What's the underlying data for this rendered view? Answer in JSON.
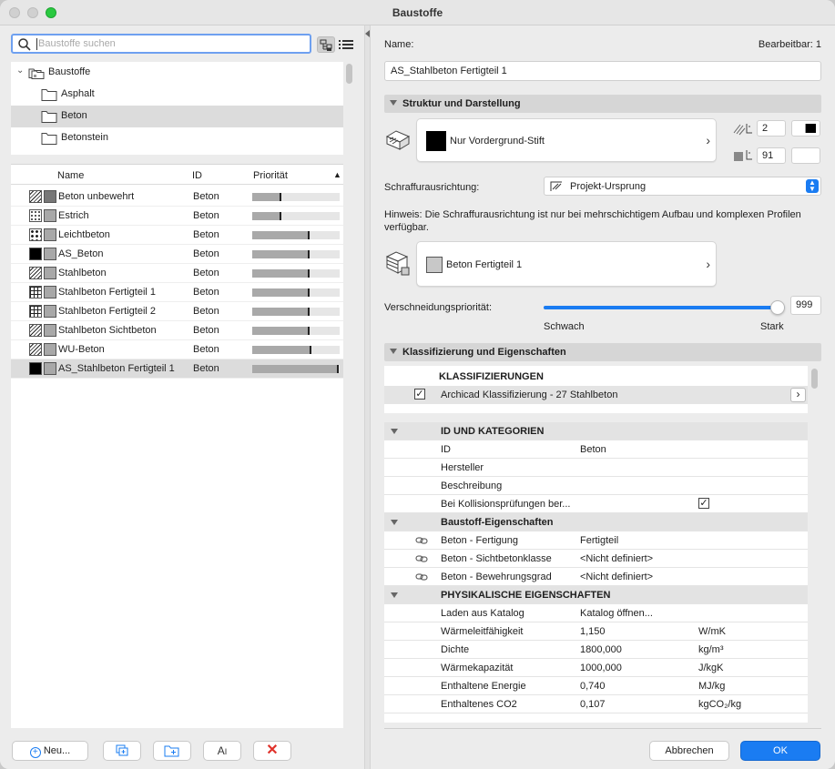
{
  "window": {
    "title": "Baustoffe"
  },
  "search": {
    "placeholder": "Baustoffe suchen"
  },
  "tree": {
    "root": "Baustoffe",
    "items": [
      "Asphalt",
      "Beton",
      "Betonstein"
    ]
  },
  "list": {
    "headers": {
      "name": "Name",
      "id": "ID",
      "priority": "Priorität"
    },
    "rows": [
      {
        "name": "Beton unbewehrt",
        "id": "Beton",
        "priority": 0.33,
        "pattern": "hatch",
        "color": "#777777"
      },
      {
        "name": "Estrich",
        "id": "Beton",
        "priority": 0.33,
        "pattern": "dots",
        "color": "#a8a8a8"
      },
      {
        "name": "Leichtbeton",
        "id": "Beton",
        "priority": 0.66,
        "pattern": "gravel",
        "color": "#a8a8a8"
      },
      {
        "name": "AS_Beton",
        "id": "Beton",
        "priority": 0.66,
        "pattern": "solid",
        "color": "#a8a8a8"
      },
      {
        "name": "Stahlbeton",
        "id": "Beton",
        "priority": 0.66,
        "pattern": "hatch",
        "color": "#a8a8a8"
      },
      {
        "name": "Stahlbeton Fertigteil 1",
        "id": "Beton",
        "priority": 0.66,
        "pattern": "grid",
        "color": "#a8a8a8"
      },
      {
        "name": "Stahlbeton Fertigteil 2",
        "id": "Beton",
        "priority": 0.66,
        "pattern": "grid",
        "color": "#a8a8a8"
      },
      {
        "name": "Stahlbeton Sichtbeton",
        "id": "Beton",
        "priority": 0.66,
        "pattern": "hatch",
        "color": "#a8a8a8"
      },
      {
        "name": "WU-Beton",
        "id": "Beton",
        "priority": 0.68,
        "pattern": "hatch",
        "color": "#a8a8a8"
      },
      {
        "name": "AS_Stahlbeton Fertigteil 1",
        "id": "Beton",
        "priority": 0.99,
        "pattern": "solid",
        "color": "#a8a8a8"
      }
    ]
  },
  "bottom_buttons": {
    "new": "Neu..."
  },
  "details": {
    "name_label": "Name:",
    "editable": "Bearbeitbar: 1",
    "name_value": "AS_Stahlbeton Fertigteil 1",
    "section_structure": "Struktur und Darstellung",
    "fill_label": "Nur Vordergrund-Stift",
    "pen1": "2",
    "pen2": "91",
    "orientation_label": "Schraffurausrichtung:",
    "orientation_value": "Projekt-Ursprung",
    "hint": "Hinweis: Die Schraffurausrichtung ist nur bei mehrschichtigem Aufbau und komplexen Profilen verfügbar.",
    "surface_label": "Beton Fertigteil 1",
    "priority_label": "Verschneidungspriorität:",
    "priority_value": "999",
    "priority_level": 1.0,
    "weak": "Schwach",
    "strong": "Stark",
    "section_class": "Klassifizierung und Eigenschaften",
    "class_header": "KLASSIFIZIERUNGEN",
    "class_item": "Archicad Klassifizierung - 27 Stahlbeton"
  },
  "properties": {
    "groups": [
      {
        "title": "ID UND KATEGORIEN",
        "rows": [
          {
            "label": "ID",
            "value": "Beton",
            "unit": ""
          },
          {
            "label": "Hersteller",
            "value": "",
            "unit": ""
          },
          {
            "label": "Beschreibung",
            "value": "",
            "unit": ""
          },
          {
            "label": "Bei Kollisionsprüfungen ber...",
            "value": "",
            "unit": ""
          }
        ]
      },
      {
        "title": "Baustoff-Eigenschaften",
        "rows": [
          {
            "label": "Beton - Fertigung",
            "value": "Fertigteil",
            "unit": ""
          },
          {
            "label": "Beton - Sichtbetonklasse",
            "value": "<Nicht definiert>",
            "unit": ""
          },
          {
            "label": "Beton - Bewehrungsgrad",
            "value": "<Nicht definiert>",
            "unit": ""
          }
        ]
      },
      {
        "title": "PHYSIKALISCHE EIGENSCHAFTEN",
        "rows": [
          {
            "label": "Laden aus Katalog",
            "value": "Katalog öffnen...",
            "unit": ""
          },
          {
            "label": "Wärmeleitfähigkeit",
            "value": "1,150",
            "unit": "W/mK"
          },
          {
            "label": "Dichte",
            "value": "1800,000",
            "unit": "kg/m³"
          },
          {
            "label": "Wärmekapazität",
            "value": "1000,000",
            "unit": "J/kgK"
          },
          {
            "label": "Enthaltene Energie",
            "value": "0,740",
            "unit": "MJ/kg"
          },
          {
            "label": "Enthaltenes CO2",
            "value": "0,107",
            "unit": "kgCO₂/kg"
          }
        ]
      }
    ]
  },
  "buttons": {
    "cancel": "Abbrechen",
    "ok": "OK"
  },
  "colors": {
    "accent": "#1a7cf2",
    "selection": "#dcdcdc"
  }
}
